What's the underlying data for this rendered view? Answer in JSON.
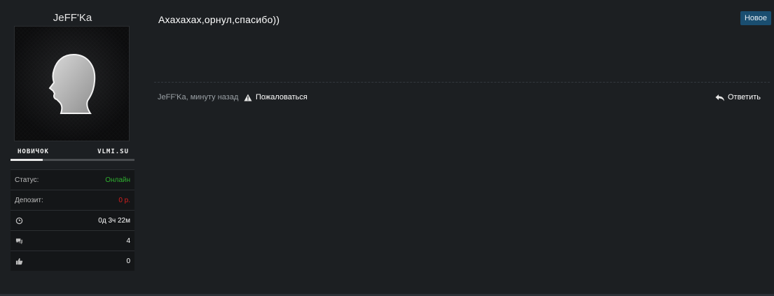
{
  "user": {
    "name": "JeFF'Ka",
    "rank_label": "НОВИЧОК",
    "rank_site": "VLMI.SU",
    "rank_progress": 0.26
  },
  "stats": {
    "status_label": "Статус:",
    "status_value": "Онлайн",
    "status_color": "#2fae2f",
    "deposit_label": "Депозит:",
    "deposit_value": "0 р.",
    "deposit_color": "#d61f1f",
    "time_icon": "clock-icon",
    "time_value": "0д 3ч 22м",
    "messages_icon": "comments-icon",
    "messages_value": "4",
    "likes_icon": "thumbs-up-icon",
    "likes_value": "0"
  },
  "post": {
    "message": "Ахахахах,орнул,спасибо))",
    "badge": "Новое",
    "badge_color": "#1a4e70",
    "meta": "JeFF'Ka, минуту назад",
    "report_label": "Пожаловаться",
    "reply_label": "Ответить"
  }
}
